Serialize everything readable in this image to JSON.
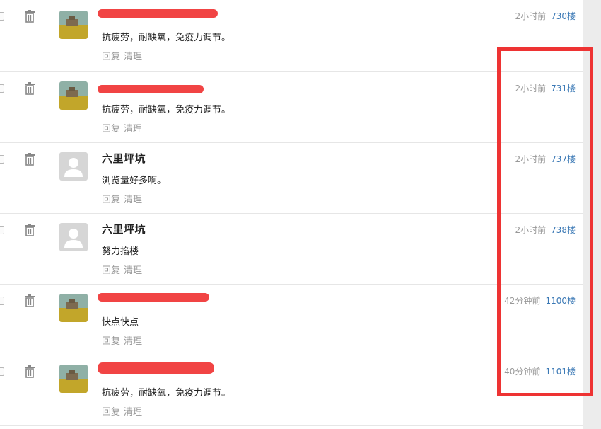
{
  "comments": [
    {
      "username": "",
      "avatar": "landscape-photo",
      "text": "抗疲劳，耐缺氧，免疫力调节。",
      "time": "2小时前",
      "floor": "730楼",
      "redacted": true
    },
    {
      "username": "",
      "avatar": "landscape-photo",
      "text": "抗疲劳，耐缺氧，免疫力调节。",
      "time": "2小时前",
      "floor": "731楼",
      "redacted": true
    },
    {
      "username": "六里坪坑",
      "avatar": "default-user",
      "text": "浏览量好多啊。",
      "time": "2小时前",
      "floor": "737楼",
      "redacted": false
    },
    {
      "username": "六里坪坑",
      "avatar": "default-user",
      "text": "努力掐楼",
      "time": "2小时前",
      "floor": "738楼",
      "redacted": false
    },
    {
      "username": "",
      "avatar": "landscape-photo",
      "text": "快点快点",
      "time": "42分钟前",
      "floor": "1100楼",
      "redacted": true
    },
    {
      "username": "",
      "avatar": "landscape-photo",
      "text": "抗疲劳，耐缺氧，免疫力调节。",
      "time": "40分钟前",
      "floor": "1101楼",
      "redacted": true
    }
  ],
  "actions": {
    "reply": "回复",
    "clear": "清理"
  },
  "colors": {
    "floor_link": "#3a78b5",
    "meta_text": "#999999",
    "annotation": "#ee3333",
    "redaction": "#f03a3a"
  }
}
